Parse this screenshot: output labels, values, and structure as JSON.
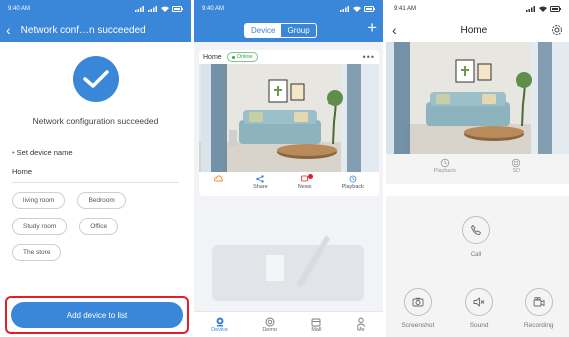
{
  "phone1": {
    "status_time": "9:40 AM",
    "title": "Network conf…n succeeded",
    "success_message": "Network configuration succeeded",
    "set_name_label": "Set device name",
    "device_name_value": "Home",
    "room_chips": [
      "living room",
      "Bedroom",
      "Study room",
      "Office",
      "The store"
    ],
    "add_button_label": "Add device to list",
    "highlight_color": "#e21f26",
    "accent_color": "#3a86d8"
  },
  "phone2": {
    "status_time": "9:40 AM",
    "segment": {
      "device": "Device",
      "group": "Group"
    },
    "card": {
      "name": "Home",
      "status": "Online",
      "actions": [
        "",
        "Share",
        "News",
        "Playback"
      ]
    },
    "tabs": [
      "Device",
      "Demo",
      "Mall",
      "Me"
    ]
  },
  "phone3": {
    "status_time": "9:41 AM",
    "title": "Home",
    "controls": [
      "Playback",
      "SD"
    ],
    "call_label": "Call",
    "bottom_controls": [
      "Screenshot",
      "Sound",
      "Recording"
    ]
  }
}
